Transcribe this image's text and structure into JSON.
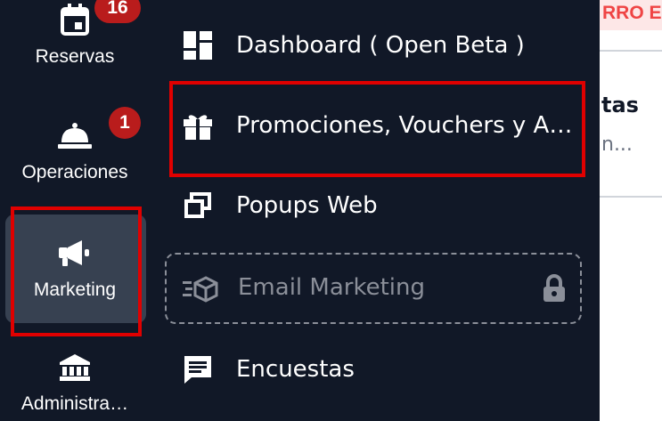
{
  "rail": {
    "reservas": {
      "label": "Reservas",
      "badge": "16",
      "icon": "calendar-icon"
    },
    "operaciones": {
      "label": "Operaciones",
      "badge": "1",
      "icon": "service-bell-icon"
    },
    "marketing": {
      "label": "Marketing",
      "icon": "megaphone-icon",
      "active": true
    },
    "administracion": {
      "label": "Administra…",
      "icon": "bank-icon"
    }
  },
  "submenu": {
    "items": [
      {
        "label": "Dashboard ( Open Beta )",
        "icon": "dashboard-icon"
      },
      {
        "label": "Promociones, Vouchers y A…",
        "icon": "gift-icon"
      },
      {
        "label": "Popups Web",
        "icon": "windows-icon"
      },
      {
        "label": "Email Marketing",
        "icon": "email-cube-icon",
        "locked": true,
        "lock_icon": "lock-icon"
      },
      {
        "label": "Encuestas",
        "icon": "message-icon"
      }
    ]
  },
  "content": {
    "banner": "RRO ES",
    "title": "tas",
    "subtitle": "n..."
  },
  "colors": {
    "background": "#111827",
    "active": "#374151",
    "badge": "#b91c1c",
    "highlight": "#e00000",
    "muted": "#8b8f99"
  }
}
